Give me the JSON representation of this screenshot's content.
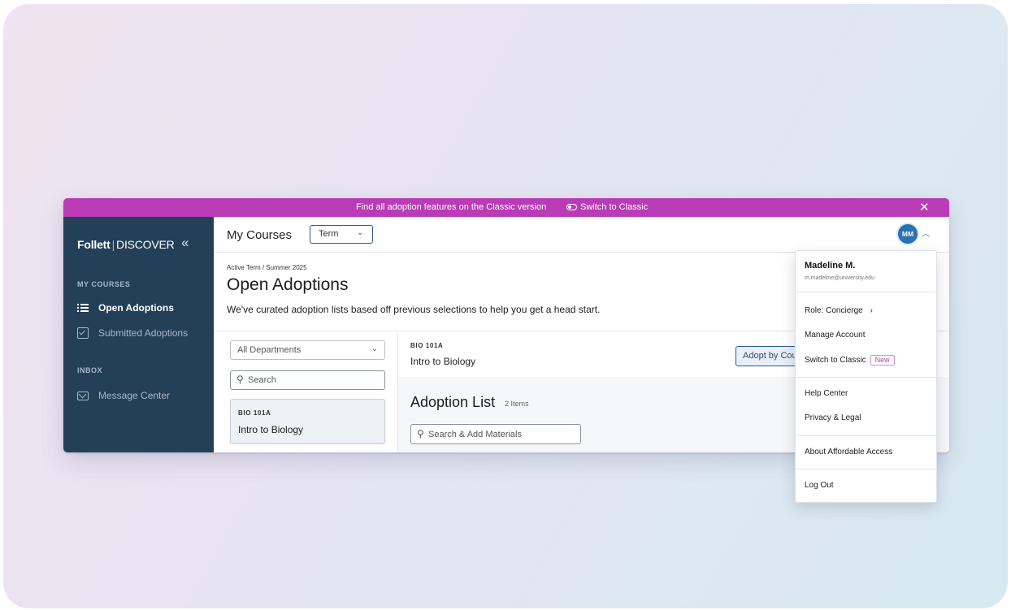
{
  "banner": {
    "message": "Find all adoption features on the Classic version",
    "switch_label": "Switch to Classic",
    "close_glyph": "✕"
  },
  "sidebar": {
    "brand": "Follett",
    "product": "DISCOVER",
    "collapse_glyph": "«",
    "sections": [
      {
        "label": "MY COURSES",
        "items": [
          {
            "label": "Open Adoptions",
            "icon": "list-icon",
            "active": true
          },
          {
            "label": "Submitted Adoptions",
            "icon": "checkbox-icon",
            "active": false
          }
        ]
      },
      {
        "label": "INBOX",
        "items": [
          {
            "label": "Message Center",
            "icon": "mail-icon",
            "active": false
          }
        ]
      }
    ]
  },
  "header": {
    "title": "My Courses",
    "term_select": "Term",
    "avatar_initials": "MM"
  },
  "page": {
    "breadcrumb": "Active Term / Summer 2025",
    "title": "Open Adoptions",
    "subtitle": "We've curated adoption lists based off previous selections to help you get a head start."
  },
  "filters": {
    "department": "All Departments",
    "search_placeholder": "Search"
  },
  "courses": [
    {
      "code": "BIO 101A",
      "name": "Intro to Biology"
    }
  ],
  "detail": {
    "code": "BIO 101A",
    "name": "Intro to Biology",
    "adopt_button": "Adopt by Course",
    "adoption_title": "Adoption List",
    "adoption_count": "2 Items",
    "materials_placeholder": "Search & Add Materials"
  },
  "user_menu": {
    "name": "Madeline M.",
    "email": "m.madeline@university.edu",
    "role": "Role: Concierge",
    "manage_account": "Manage Account",
    "switch_classic": "Switch to Classic",
    "new_badge": "New",
    "help_center": "Help Center",
    "privacy": "Privacy & Legal",
    "affordable_access": "About Affordable Access",
    "log_out": "Log Out"
  },
  "colors": {
    "banner": "#b93bb6",
    "sidebar": "#243f58",
    "accent": "#2b5b8f",
    "avatar": "#2c71b3"
  }
}
